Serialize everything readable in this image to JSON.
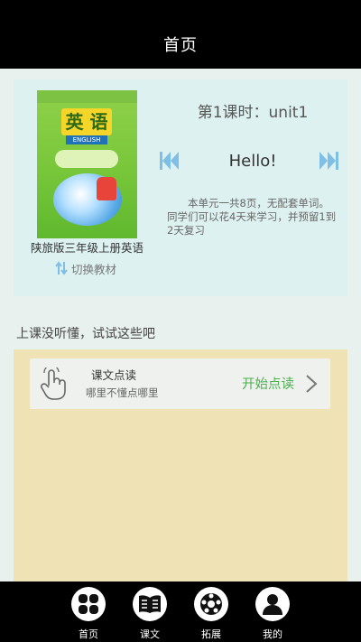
{
  "header": {
    "title": "首页"
  },
  "lesson": {
    "book_name": "陕旅版三年级上册英语",
    "switch_label": "切换教材",
    "lesson_title": "第1课时：unit1",
    "greeting": "Hello!",
    "description": "本单元一共8页，无配套单词。同学们可以花4天来学习，并预留1到2天复习",
    "cover": {
      "ying_text": "英 语",
      "eng_text": "ENGLISH"
    }
  },
  "section": {
    "title": "上课没听懂，试试这些吧"
  },
  "practice": {
    "items": [
      {
        "title": "课文点读",
        "subtitle": "哪里不懂点哪里",
        "action": "开始点读"
      }
    ]
  },
  "tabs": [
    {
      "label": "首页",
      "icon": "grid-icon"
    },
    {
      "label": "课文",
      "icon": "book-icon"
    },
    {
      "label": "拓展",
      "icon": "ball-icon"
    },
    {
      "label": "我的",
      "icon": "user-icon"
    }
  ],
  "colors": {
    "accent_blue": "#7fbfe6",
    "action_green": "#4caf50",
    "card_bg": "#ddf1f0",
    "practice_bg": "#efe3b5"
  }
}
